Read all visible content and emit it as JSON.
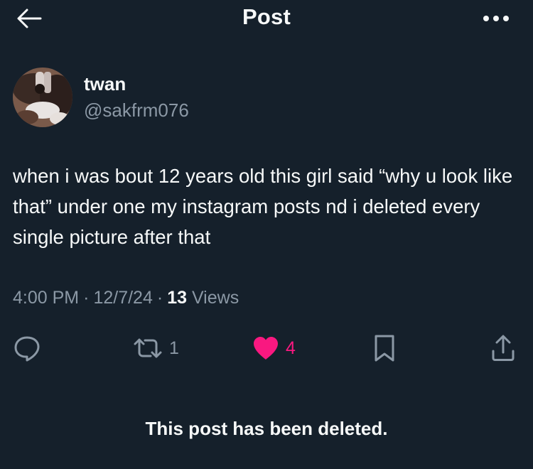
{
  "header": {
    "title": "Post"
  },
  "author": {
    "name": "twan",
    "handle": "@sakfrm076"
  },
  "post": {
    "text": "when i was bout 12 years old this girl said “why u look like that” under one my instagram posts nd i deleted every single picture after that",
    "time": "4:00 PM",
    "date": "12/7/24",
    "separator": "·",
    "views_count": "13",
    "views_label": "Views"
  },
  "actions": {
    "reply_icon": "reply-icon",
    "repost_icon": "repost-icon",
    "repost_count": "1",
    "like_icon": "heart-filled-icon",
    "like_count": "4",
    "like_color": "#f91880",
    "bookmark_icon": "bookmark-icon",
    "share_icon": "share-icon"
  },
  "notice": {
    "deleted_text": "This post has been deleted."
  },
  "colors": {
    "background": "#15202b",
    "primary_text": "#f7f9f9",
    "secondary_text": "#8b98a5",
    "like": "#f91880"
  }
}
